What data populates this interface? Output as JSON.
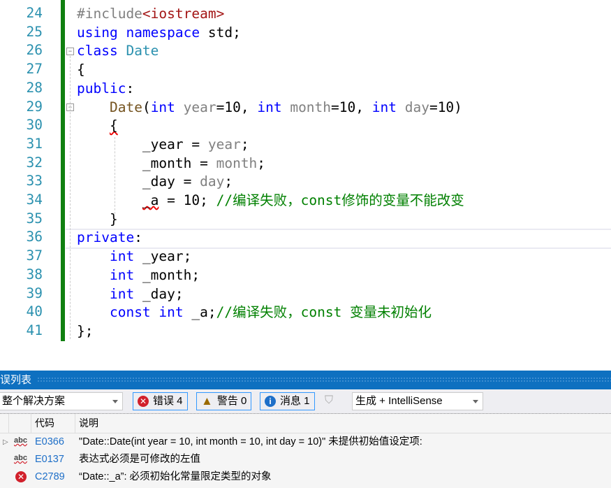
{
  "editor": {
    "lines": [
      {
        "n": "24",
        "tokens": [
          [
            "#include",
            "pp"
          ],
          [
            "<iostream>",
            "inc"
          ]
        ]
      },
      {
        "n": "25",
        "tokens": [
          [
            "using",
            "kw"
          ],
          [
            " "
          ],
          [
            "namespace",
            "kw"
          ],
          [
            " std;"
          ]
        ]
      },
      {
        "n": "26",
        "tokens": [
          [
            "class",
            "kw"
          ],
          [
            " "
          ],
          [
            "Date",
            "ty"
          ]
        ]
      },
      {
        "n": "27",
        "tokens": [
          [
            "{"
          ]
        ]
      },
      {
        "n": "28",
        "tokens": [
          [
            "public",
            "kw"
          ],
          [
            ":"
          ]
        ]
      },
      {
        "n": "29",
        "tokens": [
          [
            "    "
          ],
          [
            "Date",
            "fn"
          ],
          [
            "("
          ],
          [
            "int",
            "kw"
          ],
          [
            " "
          ],
          [
            "year",
            "par"
          ],
          [
            "=10, "
          ],
          [
            "int",
            "kw"
          ],
          [
            " "
          ],
          [
            "month",
            "par"
          ],
          [
            "=10, "
          ],
          [
            "int",
            "kw"
          ],
          [
            " "
          ],
          [
            "day",
            "par"
          ],
          [
            "=10)"
          ]
        ]
      },
      {
        "n": "30",
        "tokens": [
          [
            "    "
          ],
          [
            "{",
            "sq"
          ]
        ]
      },
      {
        "n": "31",
        "tokens": [
          [
            "        _year = "
          ],
          [
            "year",
            "par"
          ],
          [
            ";"
          ]
        ]
      },
      {
        "n": "32",
        "tokens": [
          [
            "        _month = "
          ],
          [
            "month",
            "par"
          ],
          [
            ";"
          ]
        ]
      },
      {
        "n": "33",
        "tokens": [
          [
            "        _day = "
          ],
          [
            "day",
            "par"
          ],
          [
            ";"
          ]
        ]
      },
      {
        "n": "34",
        "tokens": [
          [
            "        "
          ],
          [
            "_a",
            "sq"
          ],
          [
            " = 10; "
          ],
          [
            "//编译失败，const修饰的变量不能改变",
            "cm"
          ]
        ]
      },
      {
        "n": "35",
        "tokens": [
          [
            "    }"
          ]
        ]
      },
      {
        "n": "36",
        "tokens": [
          [
            "private",
            "kw"
          ],
          [
            ":"
          ]
        ]
      },
      {
        "n": "37",
        "tokens": [
          [
            "    "
          ],
          [
            "int",
            "kw"
          ],
          [
            " _year;"
          ]
        ]
      },
      {
        "n": "38",
        "tokens": [
          [
            "    "
          ],
          [
            "int",
            "kw"
          ],
          [
            " _month;"
          ]
        ]
      },
      {
        "n": "39",
        "tokens": [
          [
            "    "
          ],
          [
            "int",
            "kw"
          ],
          [
            " _day;"
          ]
        ]
      },
      {
        "n": "40",
        "tokens": [
          [
            "    "
          ],
          [
            "const",
            "kw"
          ],
          [
            " "
          ],
          [
            "int",
            "kw"
          ],
          [
            " _a;"
          ],
          [
            "//编译失败，const 变量未初始化",
            "cm"
          ]
        ]
      },
      {
        "n": "41",
        "tokens": [
          [
            "};"
          ]
        ]
      }
    ]
  },
  "panel": {
    "title": "误列表",
    "scope": "整个解决方案",
    "errors_label": "错误 4",
    "warnings_label": "警告 0",
    "messages_label": "消息 1",
    "source": "生成 + IntelliSense",
    "columns": {
      "code": "代码",
      "desc": "说明"
    },
    "rows": [
      {
        "icon": "abc-squiggle-icon",
        "code": "E0366",
        "desc": "\"Date::Date(int year = 10, int month = 10, int day = 10)\" 未提供初始值设定项:"
      },
      {
        "icon": "abc-squiggle-icon",
        "code": "E0137",
        "desc": "表达式必须是可修改的左值"
      },
      {
        "icon": "error-icon",
        "code": "C2789",
        "desc": "“Date::_a”: 必须初始化常量限定类型的对象"
      }
    ]
  },
  "colors": {
    "accent": "#0e70c0",
    "error": "#d1202b",
    "warning": "#9a6a00",
    "info": "#1e6fc8"
  }
}
